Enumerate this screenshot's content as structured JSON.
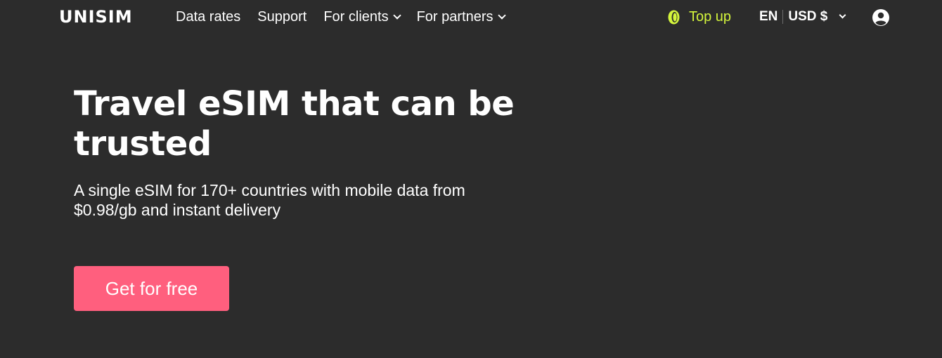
{
  "header": {
    "logo": "UNISIM",
    "nav": {
      "data_rates": "Data rates",
      "support": "Support",
      "for_clients": "For clients",
      "for_partners": "For partners"
    },
    "top_up": "Top up",
    "language": "EN",
    "currency": "USD $",
    "icons": {
      "coin": "coin-icon",
      "account": "account-icon",
      "dropdown": "chevron-down-icon"
    }
  },
  "hero": {
    "title": "Travel eSIM that can be trusted",
    "subtitle": "A single eSIM for 170+ countries with mobile data from $0.98/gb and instant delivery",
    "cta": "Get for free"
  },
  "colors": {
    "background": "#2c2c2c",
    "accent_lime": "#d4f53c",
    "cta_pink": "#ff5f7e",
    "text": "#ffffff"
  }
}
